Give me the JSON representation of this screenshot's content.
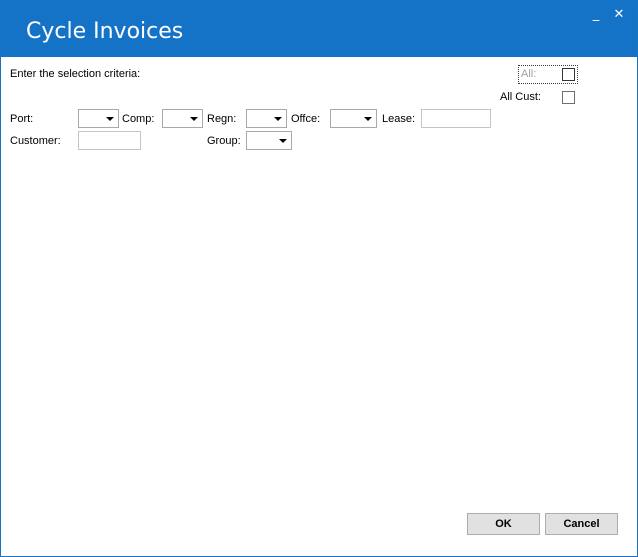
{
  "window": {
    "title": "Cycle Invoices",
    "minimize_glyph": "_",
    "close_glyph": "✕"
  },
  "criteria": {
    "prompt": "Enter the selection criteria:",
    "all_label": "All:",
    "all_checked": false,
    "all_cust_label": "All Cust:",
    "all_cust_checked": false
  },
  "fields": {
    "port_label": "Port:",
    "port_value": "",
    "comp_label": "Comp:",
    "comp_value": "",
    "regn_label": "Regn:",
    "regn_value": "",
    "offce_label": "Offce:",
    "offce_value": "",
    "lease_label": "Lease:",
    "lease_value": "",
    "customer_label": "Customer:",
    "customer_value": "",
    "group_label": "Group:",
    "group_value": ""
  },
  "buttons": {
    "ok_label": "OK",
    "cancel_label": "Cancel"
  },
  "colors": {
    "titlebar": "#1573c7",
    "title_text": "#ffffff"
  }
}
